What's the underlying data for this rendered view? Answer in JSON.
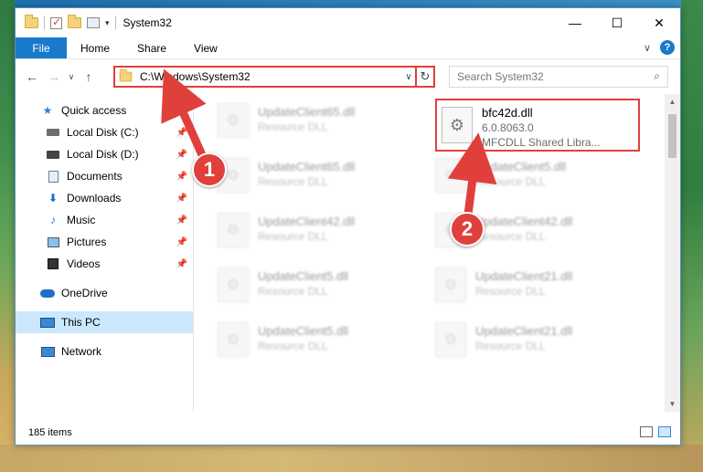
{
  "window": {
    "title": "System32",
    "controls": {
      "minimize": "—",
      "maximize": "☐",
      "close": "✕"
    }
  },
  "quick_access_toolbar": {
    "dropdown_glyph": "▾"
  },
  "ribbon": {
    "tabs": [
      "File",
      "Home",
      "Share",
      "View"
    ],
    "expand_glyph": "∨",
    "help_glyph": "?"
  },
  "address_bar": {
    "path": "C:\\Windows\\System32",
    "dropdown_glyph": "∨",
    "refresh_glyph": "↻",
    "search_placeholder": "Search System32",
    "search_glyph": "⌕"
  },
  "nav": {
    "back": "←",
    "forward": "→",
    "recent": "∨",
    "up": "↑"
  },
  "sidebar": {
    "items": [
      {
        "label": "Quick access",
        "icon": "star-icon"
      },
      {
        "label": "Local Disk (C:)",
        "icon": "drive-icon",
        "pinned": true
      },
      {
        "label": "Local Disk (D:)",
        "icon": "drive-icon",
        "pinned": true
      },
      {
        "label": "Documents",
        "icon": "documents-icon",
        "pinned": true
      },
      {
        "label": "Downloads",
        "icon": "downloads-icon",
        "pinned": true
      },
      {
        "label": "Music",
        "icon": "music-icon",
        "pinned": true
      },
      {
        "label": "Pictures",
        "icon": "pictures-icon",
        "pinned": true
      },
      {
        "label": "Videos",
        "icon": "videos-icon",
        "pinned": true
      },
      {
        "label": "OneDrive",
        "icon": "onedrive-icon"
      },
      {
        "label": "This PC",
        "icon": "this-pc-icon",
        "selected": true
      },
      {
        "label": "Network",
        "icon": "network-icon"
      }
    ],
    "pin_glyph": "📌"
  },
  "files": {
    "left_column": [
      {
        "name": "UpdateClient65.dll",
        "type": "Resource DLL"
      },
      {
        "name": "UpdateClient65.dll",
        "type": "Resource DLL"
      },
      {
        "name": "UpdateClient42.dll",
        "type": "Resource DLL"
      },
      {
        "name": "UpdateClient5.dll",
        "type": "Resource DLL"
      },
      {
        "name": "UpdateClient5.dll",
        "type": "Resource DLL"
      }
    ],
    "right_column": [
      {
        "name": "UpdateClient5.dll",
        "type": "Resource DLL"
      },
      {
        "name": "UpdateClient42.dll",
        "type": "Resource DLL"
      },
      {
        "name": "UpdateClient21.dll",
        "type": "Resource DLL"
      },
      {
        "name": "UpdateClient21.dll",
        "type": "Resource DLL"
      }
    ],
    "highlighted": {
      "name": "bfc42d.dll",
      "version": "6.0.8063.0",
      "description": "MFCDLL Shared Libra..."
    }
  },
  "status_bar": {
    "item_count": "185 items"
  },
  "callouts": {
    "step1": "1",
    "step2": "2"
  },
  "colors": {
    "accent": "#1979ca",
    "highlight": "#e0403c",
    "selected": "#cce8ff"
  }
}
